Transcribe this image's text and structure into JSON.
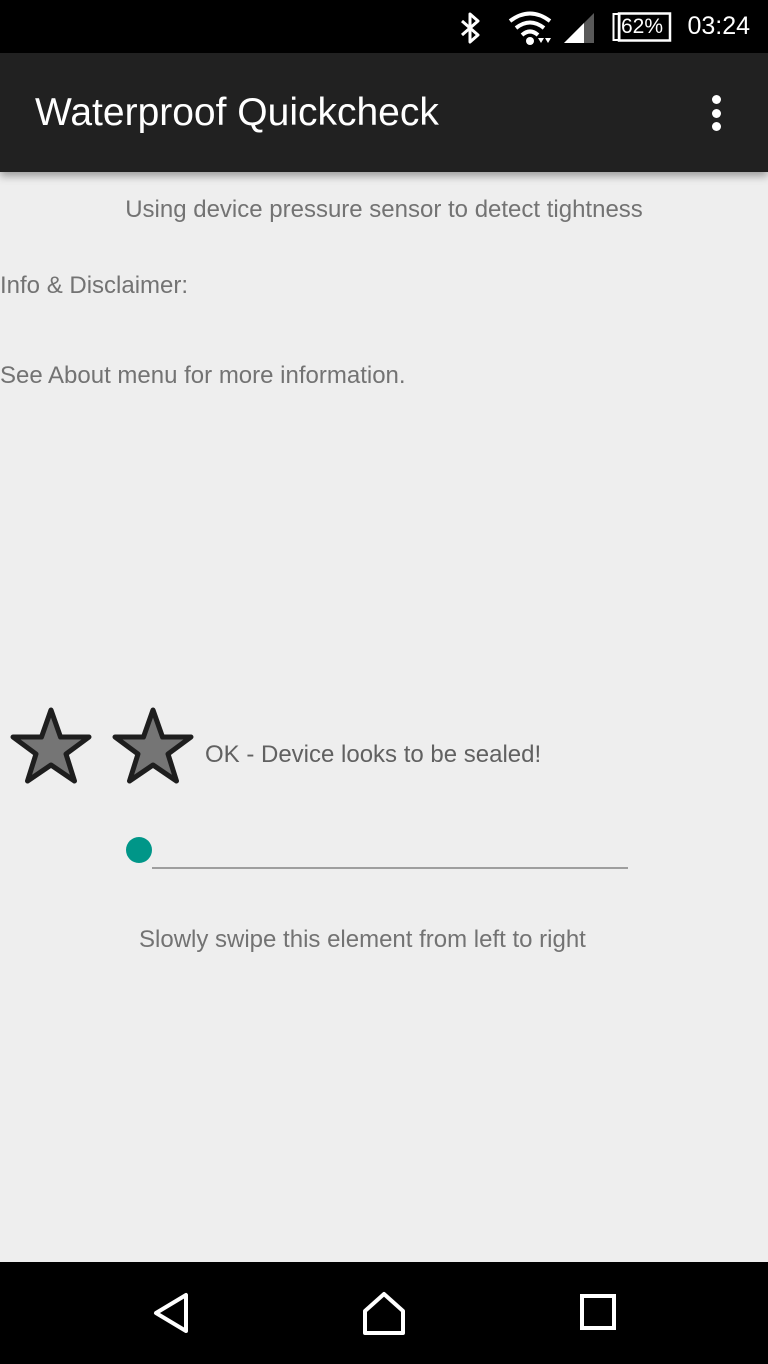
{
  "status_bar": {
    "bluetooth_icon": "bluetooth-icon",
    "wifi_icon": "wifi-icon",
    "signal_icon": "cell-signal-icon",
    "battery_level": "62%",
    "time": "03:24"
  },
  "app_bar": {
    "title": "Waterproof Quickcheck",
    "overflow_icon": "more-vertical-icon"
  },
  "main": {
    "subtitle": "Using device pressure sensor to detect tightness",
    "info_heading": "Info & Disclaimer:",
    "info_text": "See About menu for more information.",
    "rating": {
      "stars": 2,
      "star_color": "#757575"
    },
    "status_message": "OK - Device looks to be sealed!",
    "swipe": {
      "progress": 0,
      "accent_color": "#009688"
    },
    "swipe_hint": "Slowly swipe this element from left to right"
  },
  "nav_bar": {
    "back_icon": "back-icon",
    "home_icon": "home-icon",
    "recents_icon": "recents-icon"
  }
}
